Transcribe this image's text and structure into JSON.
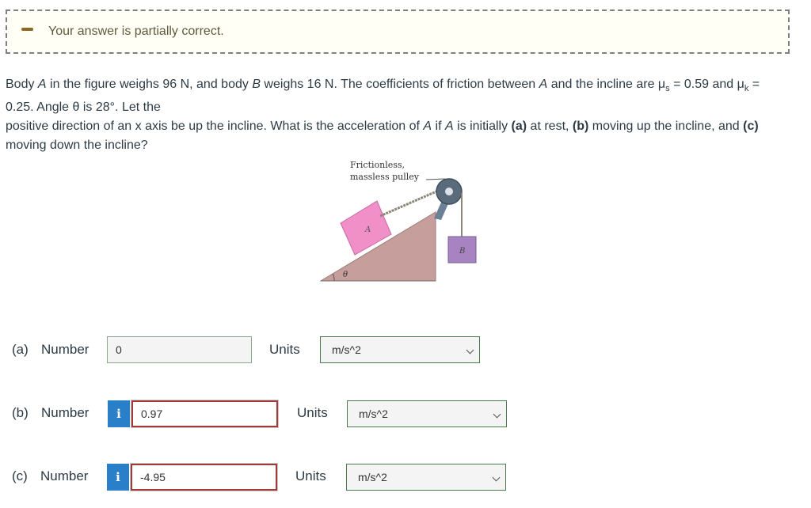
{
  "banner": {
    "message": "Your answer is partially correct."
  },
  "question": {
    "line1_a": "Body ",
    "line1_A": "A",
    "line1_b": " in the figure weighs 96 N, and body ",
    "line1_B": "B",
    "line1_c": " weighs 16 N. The coefficients of friction between ",
    "line1_A2": "A",
    "line1_d": " and the incline are μ",
    "mu_s_sub": "s",
    "line1_e": " = 0.59 and μ",
    "mu_k_sub": "k",
    "line1_f": " =",
    "line2": "0.25. Angle θ is 28°. Let the",
    "line3_a": "positive direction of an x axis be up the incline. What is the acceleration of ",
    "line3_A": "A",
    "line3_b": " if ",
    "line3_A2": "A",
    "line3_c": " is initially ",
    "part_a": "(a)",
    "line3_d": " at rest, ",
    "part_b": "(b)",
    "line3_e": " moving up the incline, and ",
    "part_c": "(c)",
    "line4": "moving down the incline?"
  },
  "figure": {
    "pulley_label_1": "Frictionless,",
    "pulley_label_2": "massless pulley",
    "block_a": "A",
    "block_b": "B",
    "angle": "θ",
    "colors": {
      "incline": "#c69e9c",
      "block_a": "#f08fc8",
      "block_b": "#a784c1"
    }
  },
  "answers": [
    {
      "part": "(a)",
      "number_label": "Number",
      "value": "0",
      "units_label": "Units",
      "unit": "m/s^2",
      "status": "correct"
    },
    {
      "part": "(b)",
      "number_label": "Number",
      "value": "0.97",
      "units_label": "Units",
      "unit": "m/s^2",
      "status": "incorrect",
      "info_icon": "i"
    },
    {
      "part": "(c)",
      "number_label": "Number",
      "value": "-4.95",
      "units_label": "Units",
      "unit": "m/s^2",
      "status": "incorrect",
      "info_icon": "i"
    }
  ]
}
